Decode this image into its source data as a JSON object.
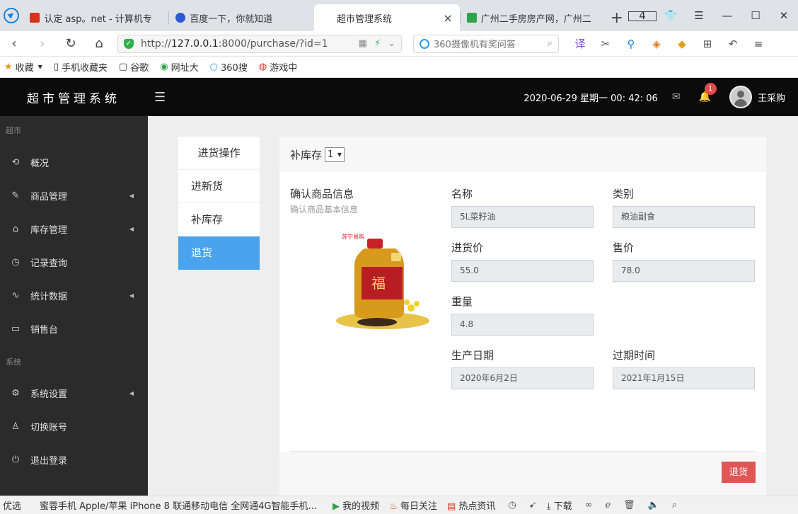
{
  "browser": {
    "tabs": [
      {
        "title": "认定 asp。net - 计算机专",
        "color": "#d9321c",
        "active": false
      },
      {
        "title": "百度一下，你就知道",
        "color": "#2d5bd6",
        "active": false
      },
      {
        "title": "超市管理系统",
        "color": "",
        "active": true,
        "close": "×"
      },
      {
        "title": "广州二手房房产网，广州二",
        "color": "#2fa44b",
        "active": false
      }
    ],
    "new_tab": "+",
    "tab_count": "4",
    "url_plain": "http://",
    "url_host": "127.0.0.1",
    "url_rest": ":8000/purchase/?id=1",
    "search_placeholder": "360摄像机有奖问答",
    "bookmarks": [
      {
        "icon": "★",
        "label": "收藏"
      },
      {
        "icon": "▯",
        "label": "手机收藏夹"
      },
      {
        "icon": "▢",
        "label": "谷歌"
      },
      {
        "icon": "◉",
        "label": "网址大"
      },
      {
        "icon": "○",
        "label": "360搜"
      },
      {
        "icon": "◍",
        "label": "游戏中"
      }
    ]
  },
  "app": {
    "title": "超市管理系统",
    "datetime": "2020-06-29 星期一 00: 42: 06",
    "notification_count": "1",
    "username": "王采购"
  },
  "sidebar": {
    "section_market": "超市",
    "market_items": [
      {
        "label": "概况",
        "icon": "⟲",
        "caret": ""
      },
      {
        "label": "商品管理",
        "icon": "✎",
        "caret": "◀"
      },
      {
        "label": "库存管理",
        "icon": "⌂",
        "caret": "◀"
      },
      {
        "label": "记录查询",
        "icon": "◷",
        "caret": ""
      },
      {
        "label": "统计数据",
        "icon": "∿",
        "caret": "◀"
      },
      {
        "label": "销售台",
        "icon": "▭",
        "caret": ""
      }
    ],
    "section_system": "系统",
    "system_items": [
      {
        "label": "系统设置",
        "icon": "⚙",
        "caret": "◀"
      },
      {
        "label": "切换账号",
        "icon": "♙",
        "caret": ""
      },
      {
        "label": "退出登录",
        "icon": "⏻",
        "caret": ""
      }
    ]
  },
  "subnav": {
    "heading": "进货操作",
    "items": [
      "进新货",
      "补库存",
      "退货"
    ],
    "active_index": 2
  },
  "panel": {
    "header_label": "补库存",
    "header_select_value": "1",
    "confirm_title": "确认商品信息",
    "confirm_subtitle": "确认商品基本信息",
    "product_brand": "福",
    "product_store_label": "苏宁易购",
    "fields": {
      "name": {
        "label": "名称",
        "value": "5L菜籽油"
      },
      "category": {
        "label": "类别",
        "value": "粮油副食"
      },
      "purchase_price": {
        "label": "进货价",
        "value": "55.0"
      },
      "sale_price": {
        "label": "售价",
        "value": "78.0"
      },
      "weight": {
        "label": "重量",
        "value": "4.8"
      },
      "production_date": {
        "label": "生产日期",
        "value": "2020年6月2日"
      },
      "expiry_date": {
        "label": "过期时间",
        "value": "2021年1月15日"
      }
    },
    "return_button": "退货"
  },
  "statusbar": {
    "left": "优选",
    "news": "蜜蓉手机 Apple/苹果 iPhone 8 联通移动电信 全网通4G智能手机...",
    "items": [
      "我的视频",
      "每日关注",
      "热点资讯",
      "下载"
    ]
  }
}
